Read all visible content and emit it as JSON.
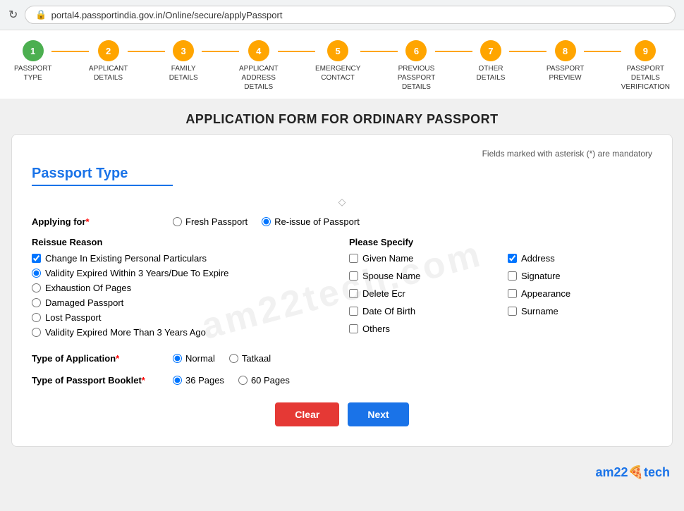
{
  "browser": {
    "url": "portal4.passportindia.gov.in/Online/secure/applyPassport",
    "lock_icon": "🔒"
  },
  "steps": [
    {
      "number": "1",
      "label": "PASSPORT TYPE",
      "state": "active"
    },
    {
      "number": "2",
      "label": "APPLICANT DETAILS",
      "state": "pending"
    },
    {
      "number": "3",
      "label": "FAMILY DETAILS",
      "state": "pending"
    },
    {
      "number": "4",
      "label": "APPLICANT ADDRESS DETAILS",
      "state": "pending"
    },
    {
      "number": "5",
      "label": "EMERGENCY CONTACT",
      "state": "pending"
    },
    {
      "number": "6",
      "label": "PREVIOUS PASSPORT DETAILS",
      "state": "pending"
    },
    {
      "number": "7",
      "label": "OTHER DETAILS",
      "state": "pending"
    },
    {
      "number": "8",
      "label": "PASSPORT PREVIEW",
      "state": "pending"
    },
    {
      "number": "9",
      "label": "PASSPORT DETAILS VERIFICATION",
      "state": "pending"
    }
  ],
  "page": {
    "title": "APPLICATION FORM FOR ORDINARY PASSPORT",
    "mandatory_note": "Fields marked with asterisk (*) are mandatory"
  },
  "section": {
    "heading": "Passport Type",
    "applying_for_label": "Applying for",
    "applying_for_required": "*",
    "applying_options": [
      {
        "id": "fresh",
        "label": "Fresh Passport",
        "checked": false
      },
      {
        "id": "reissue",
        "label": "Re-issue of Passport",
        "checked": true
      }
    ],
    "reissue_reason": {
      "label": "Reissue Reason",
      "options": [
        {
          "id": "change",
          "label": "Change In Existing Personal Particulars",
          "checked": true,
          "type": "checkbox"
        },
        {
          "id": "validity3",
          "label": "Validity Expired Within 3 Years/Due To Expire",
          "checked": true,
          "type": "radio"
        },
        {
          "id": "exhaustion",
          "label": "Exhaustion Of Pages",
          "checked": false,
          "type": "radio"
        },
        {
          "id": "damaged",
          "label": "Damaged Passport",
          "checked": false,
          "type": "radio"
        },
        {
          "id": "lost",
          "label": "Lost Passport",
          "checked": false,
          "type": "radio"
        },
        {
          "id": "validity3plus",
          "label": "Validity Expired More Than 3 Years Ago",
          "checked": false,
          "type": "radio"
        }
      ]
    },
    "please_specify": {
      "label": "Please Specify",
      "options": [
        {
          "id": "given_name",
          "label": "Given Name",
          "checked": false
        },
        {
          "id": "address",
          "label": "Address",
          "checked": true
        },
        {
          "id": "spouse_name",
          "label": "Spouse Name",
          "checked": false
        },
        {
          "id": "signature",
          "label": "Signature",
          "checked": false
        },
        {
          "id": "delete_ecr",
          "label": "Delete Ecr",
          "checked": false
        },
        {
          "id": "appearance",
          "label": "Appearance",
          "checked": false
        },
        {
          "id": "dob",
          "label": "Date Of Birth",
          "checked": false
        },
        {
          "id": "surname",
          "label": "Surname",
          "checked": false
        },
        {
          "id": "others",
          "label": "Others",
          "checked": false
        }
      ]
    },
    "type_of_application_label": "Type of Application",
    "type_of_application_required": "*",
    "application_options": [
      {
        "id": "normal",
        "label": "Normal",
        "checked": true
      },
      {
        "id": "tatkaal",
        "label": "Tatkaal",
        "checked": false
      }
    ],
    "type_of_booklet_label": "Type of Passport Booklet",
    "type_of_booklet_required": "*",
    "booklet_options": [
      {
        "id": "36pages",
        "label": "36 Pages",
        "checked": true
      },
      {
        "id": "60pages",
        "label": "60 Pages",
        "checked": false
      }
    ]
  },
  "buttons": {
    "clear": "Clear",
    "next": "Next"
  },
  "branding": {
    "text": "am22",
    "emoji": "🍕",
    "suffix": "tech"
  }
}
